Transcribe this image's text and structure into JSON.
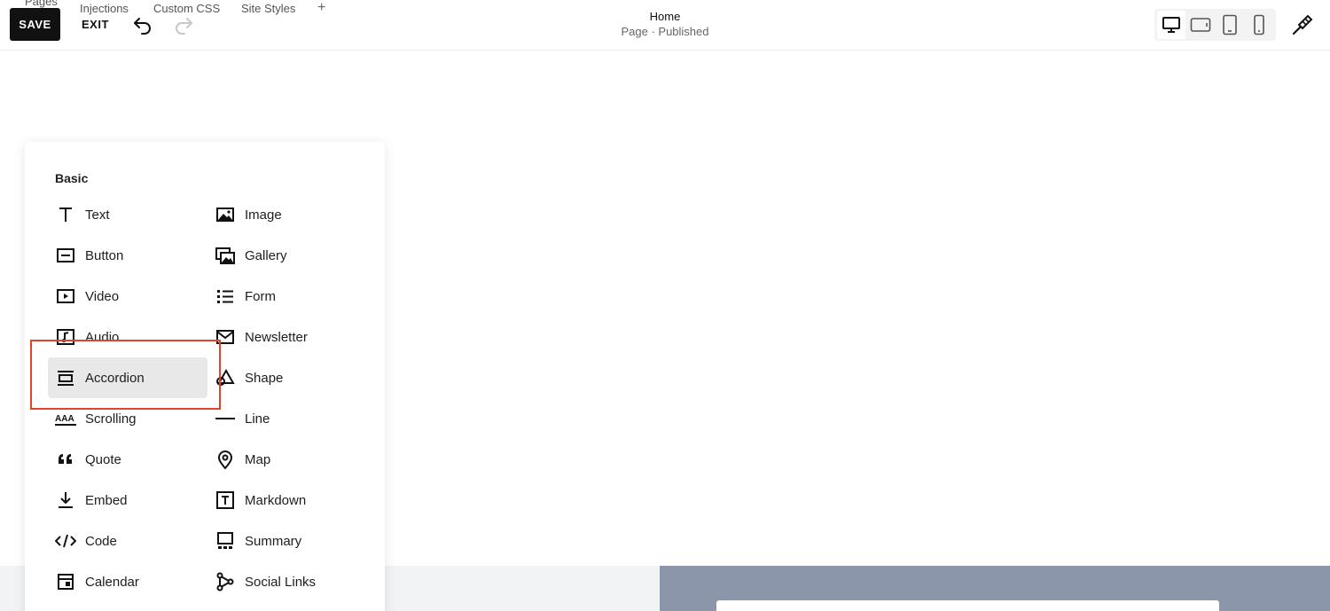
{
  "header": {
    "tabs": [
      {
        "label": "Pages"
      },
      {
        "label": "Injections"
      },
      {
        "label": "Custom CSS"
      },
      {
        "label": "Site Styles"
      }
    ],
    "add_tab_label": "+",
    "save_label": "SAVE",
    "exit_label": "EXIT",
    "page_title": "Home",
    "page_status": "Page · Published",
    "devices": [
      "desktop-icon",
      "tablet-landscape-icon",
      "tablet-portrait-icon",
      "phone-icon"
    ],
    "active_device": "desktop"
  },
  "panel": {
    "section_title": "Basic",
    "items_left": [
      {
        "label": "Text",
        "icon": "text-icon"
      },
      {
        "label": "Button",
        "icon": "button-icon"
      },
      {
        "label": "Video",
        "icon": "video-icon"
      },
      {
        "label": "Audio",
        "icon": "audio-icon"
      },
      {
        "label": "Accordion",
        "icon": "accordion-icon",
        "selected": true
      },
      {
        "label": "Scrolling",
        "icon": "scrolling-icon"
      },
      {
        "label": "Quote",
        "icon": "quote-icon"
      },
      {
        "label": "Embed",
        "icon": "embed-icon"
      },
      {
        "label": "Code",
        "icon": "code-icon"
      },
      {
        "label": "Calendar",
        "icon": "calendar-icon"
      }
    ],
    "items_right": [
      {
        "label": "Image",
        "icon": "image-icon"
      },
      {
        "label": "Gallery",
        "icon": "gallery-icon"
      },
      {
        "label": "Form",
        "icon": "form-icon"
      },
      {
        "label": "Newsletter",
        "icon": "newsletter-icon"
      },
      {
        "label": "Shape",
        "icon": "shape-icon"
      },
      {
        "label": "Line",
        "icon": "line-icon"
      },
      {
        "label": "Map",
        "icon": "map-icon"
      },
      {
        "label": "Markdown",
        "icon": "markdown-icon"
      },
      {
        "label": "Summary",
        "icon": "summary-icon"
      },
      {
        "label": "Social Links",
        "icon": "social-links-icon"
      }
    ]
  },
  "colors": {
    "highlight": "#e0452c",
    "save_bg": "#111111",
    "selected_item_bg": "#e8e8e8",
    "canvas_strip_right": "#8b96aa"
  }
}
